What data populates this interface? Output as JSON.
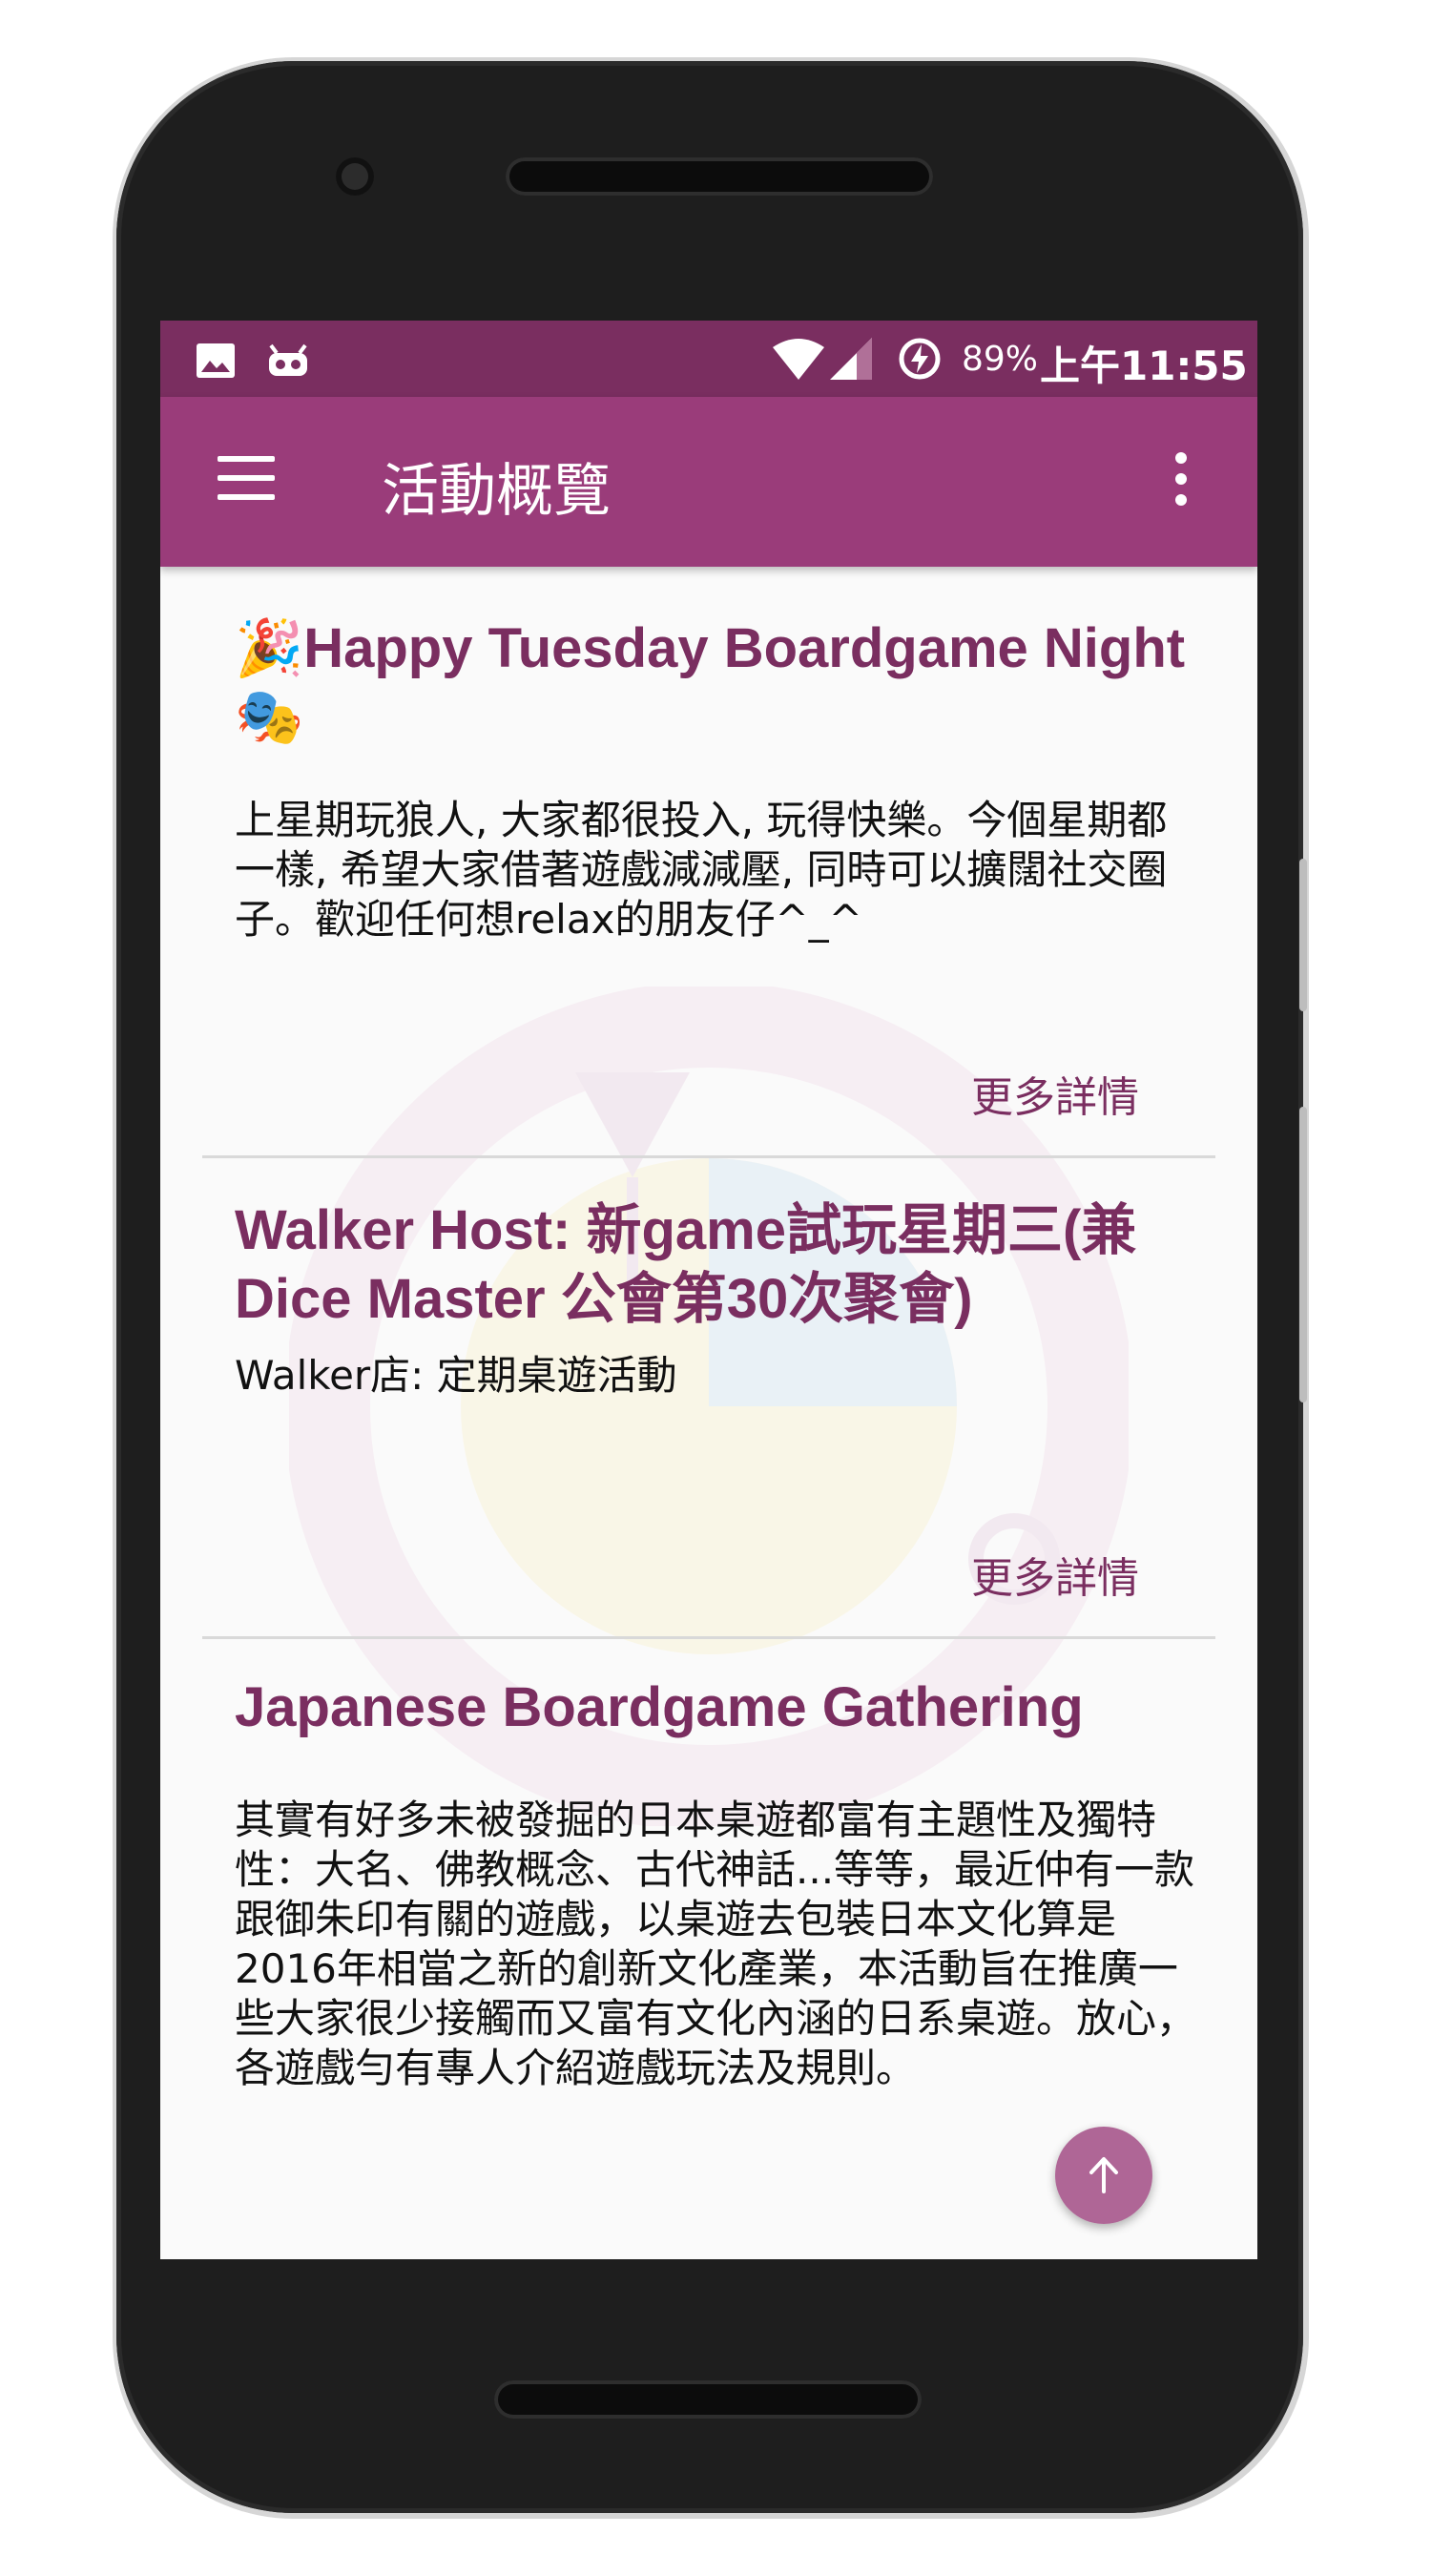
{
  "status_bar": {
    "battery": "89%",
    "time": "上午11:55",
    "icons": [
      "image-icon",
      "notification-robot-icon",
      "wifi-icon",
      "signal-icon",
      "battery-saver-icon"
    ]
  },
  "app_bar": {
    "title": "活動概覽",
    "icons": [
      "menu-icon",
      "overflow-menu-icon"
    ]
  },
  "events": [
    {
      "title": "🎉Happy Tuesday Boardgame Night🎭",
      "description": "上星期玩狼人, 大家都很投入, 玩得快樂。今個星期都一樣, 希望大家借著遊戲減減壓, 同時可以擴闊社交圈子。歡迎任何想relax的朋友仔^_^",
      "more_label": "更多詳情"
    },
    {
      "title": "Walker Host: 新game試玩星期三(兼Dice Master 公會第30次聚會)",
      "description": "Walker店: 定期桌遊活動",
      "more_label": "更多詳情"
    },
    {
      "title": "Japanese Boardgame Gathering",
      "description": "其實有好多未被發掘的日本桌遊都富有主題性及獨特性：大名、佛教概念、古代神話...等等，最近仲有一款跟御朱印有關的遊戲，以桌遊去包裝日本文化算是2016年相當之新的創新文化產業，本活動旨在推廣一些大家很少接觸而又富有文化內涵的日系桌遊。放心，各遊戲勻有專人介紹遊戲玩法及規則。"
    }
  ],
  "fab": {
    "icon": "arrow-up-icon"
  },
  "colors": {
    "status_bar": "#7a2e60",
    "app_bar": "#9a3c7a",
    "accent": "#7a2e60",
    "background": "#fafafa"
  }
}
